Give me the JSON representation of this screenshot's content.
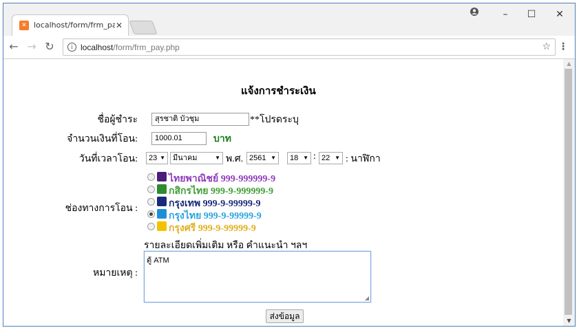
{
  "browser": {
    "tab_title": "localhost/form/frm_pay.p",
    "url_host": "localhost",
    "url_path": "/form/frm_pay.php"
  },
  "page": {
    "heading": "แจ้งการชำระเงิน",
    "payer_label": "ชื่อผู้ชำระ",
    "payer_value": "สุรชาติ บัวชุม",
    "required_note": "**โปรดระบุ",
    "amount_label": "จำนวนเงินที่โอน:",
    "amount_value": "1000.01",
    "amount_unit": "บาท",
    "datetime_label": "วันที่เวลาโอน:",
    "day": "23",
    "month": "มีนาคม",
    "era_label": "พ.ศ.",
    "year": "2561",
    "hour": "18",
    "colon": ":",
    "minute": "22",
    "time_suffix": ": นาฬิกา",
    "channel_label": "ช่องทางการโอน :",
    "banks": [
      {
        "label": "ไทยพาณิชย์ 999-999999-9",
        "color": "#8e3bb8",
        "icon_color": "#4b1d7a",
        "icon": "scb-icon",
        "checked": false
      },
      {
        "label": "กสิกรไทย 999-9-999999-9",
        "color": "#3f9d35",
        "icon_color": "#2e8b2e",
        "icon": "kbank-icon",
        "checked": false
      },
      {
        "label": "กรุงเทพ 999-9-99999-9",
        "color": "#1a2a7a",
        "icon_color": "#1a2a7a",
        "icon": "bbl-icon",
        "checked": false
      },
      {
        "label": "กรุงไทย 999-9-99999-9",
        "color": "#29a3e0",
        "icon_color": "#1d8fd6",
        "icon": "ktb-icon",
        "checked": true
      },
      {
        "label": "กรุงศรี 999-9-99999-9",
        "color": "#e0b01e",
        "icon_color": "#f2c200",
        "icon": "bay-icon",
        "checked": false
      }
    ],
    "detail_caption": "รายละเอียดเพิ่มเติม หรือ คำแนะนำ ฯลฯ",
    "remark_label": "หมายเหตุ :",
    "remark_value": "ตู้ ATM",
    "submit_label": "ส่งข้อมูล"
  }
}
